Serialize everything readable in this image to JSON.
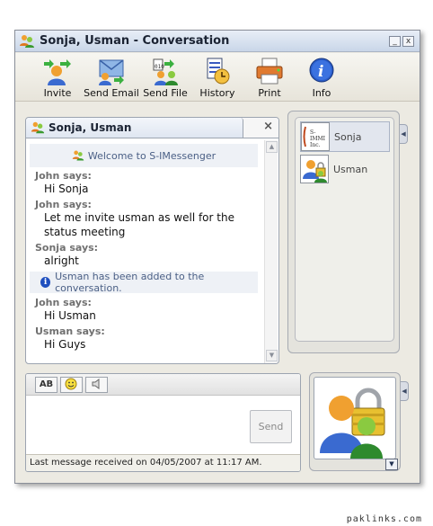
{
  "window": {
    "title": "Sonja, Usman - Conversation",
    "minimize_label": "_",
    "close_label": "x"
  },
  "toolbar": [
    {
      "label": "Invite",
      "icon": "invite-icon"
    },
    {
      "label": "Send Email",
      "icon": "send-email-icon"
    },
    {
      "label": "Send File",
      "icon": "send-file-icon"
    },
    {
      "label": "History",
      "icon": "history-icon"
    },
    {
      "label": "Print",
      "icon": "print-icon"
    },
    {
      "label": "Info",
      "icon": "info-icon"
    }
  ],
  "conversation": {
    "tab_title": "Sonja, Usman",
    "close_label": "×",
    "welcome": "Welcome to S-IMessenger",
    "messages": [
      {
        "who": "John says:",
        "text": "Hi Sonja"
      },
      {
        "who": "John says:",
        "text": "Let me invite usman as well for the status meeting"
      },
      {
        "who": "Sonja says:",
        "text": "alright"
      },
      {
        "who": "John says:",
        "text": "Hi Usman"
      },
      {
        "who": "Usman says:",
        "text": "Hi Guys"
      }
    ],
    "system_added": "Usman has been added to the conversation."
  },
  "input": {
    "format_bold_label": "AB",
    "send_label": "Send",
    "status": "Last message received on 04/05/2007 at 11:17 AM."
  },
  "roster": {
    "participants": [
      {
        "name": "Sonja",
        "avatar_text": "S-IMMI Inc."
      },
      {
        "name": "Usman"
      }
    ]
  },
  "watermark": "paklinks.com",
  "colors": {
    "accent": "#2a5cc8",
    "system_text": "#4a5f85",
    "speaker_text": "#707070"
  }
}
